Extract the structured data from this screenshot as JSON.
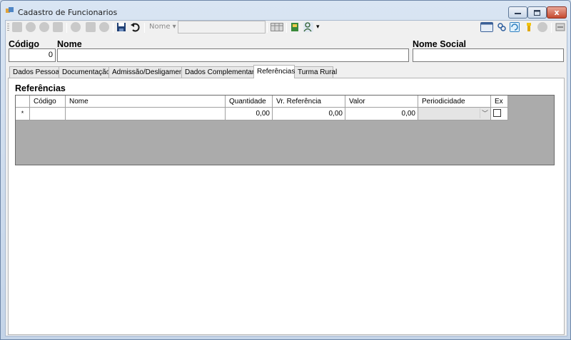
{
  "window": {
    "title": "Cadastro de Funcionarios",
    "close_glyph": "x"
  },
  "toolbar": {
    "search_field_label": "Nome",
    "search_field_value": ""
  },
  "header": {
    "codigo_label": "Código",
    "codigo_value": "0",
    "nome_label": "Nome",
    "nome_value": "",
    "nome_social_label": "Nome Social",
    "nome_social_value": ""
  },
  "tabs": [
    {
      "label": "Dados Pessoais"
    },
    {
      "label": "Documentação"
    },
    {
      "label": "Admissão/Desligamento"
    },
    {
      "label": "Dados Complementares"
    },
    {
      "label": "Referências"
    },
    {
      "label": "Turma Rural"
    }
  ],
  "active_tab": "Referências",
  "referencias": {
    "section_title": "Referências",
    "columns": [
      "Código",
      "Nome",
      "Quantidade",
      "Vr. Referência",
      "Valor",
      "Periodicidade",
      "Ex"
    ],
    "new_row": {
      "row_marker": "*",
      "codigo": "",
      "nome": "",
      "quantidade": "0,00",
      "vr_referencia": "0,00",
      "valor": "0,00",
      "periodicidade": "",
      "ex_checked": false
    }
  },
  "colors": {
    "window_frame": "#c4d4e8",
    "grid_background": "#ababab",
    "close_button": "#c54a30"
  },
  "icons": {
    "title": "app-window-icon",
    "save": "save-icon",
    "undo": "undo-icon"
  }
}
